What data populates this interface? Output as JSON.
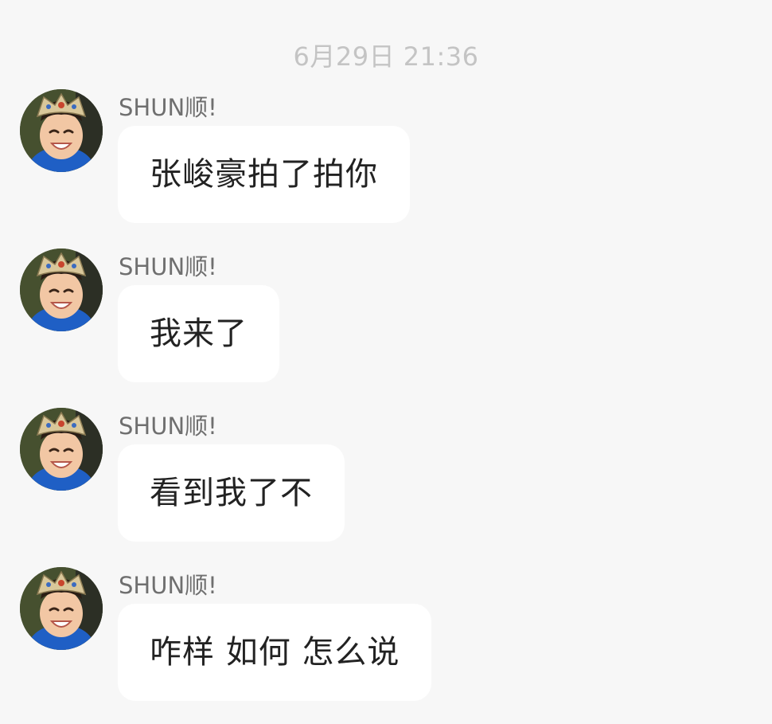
{
  "timestamp": "6月29日 21:36",
  "messages": [
    {
      "sender": "SHUN顺!",
      "text": "张峻豪拍了拍你"
    },
    {
      "sender": "SHUN顺!",
      "text": "我来了"
    },
    {
      "sender": "SHUN顺!",
      "text": "看到我了不"
    },
    {
      "sender": "SHUN顺!",
      "text": "咋样 如何 怎么说"
    }
  ]
}
